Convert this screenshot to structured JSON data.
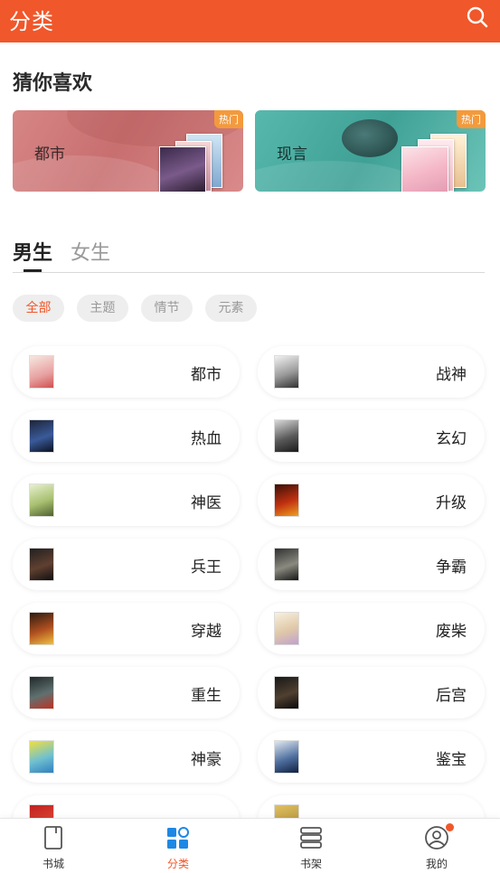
{
  "header": {
    "title": "分类",
    "search_icon": "search-icon"
  },
  "recommend": {
    "title": "猜你喜欢",
    "banners": [
      {
        "label": "都市",
        "badge": "热门",
        "color": "#d27c7d"
      },
      {
        "label": "现言",
        "badge": "热门",
        "color": "#4eafa4"
      }
    ]
  },
  "gender_tabs": {
    "active": "男生",
    "inactive": "女生"
  },
  "filters": [
    {
      "label": "全部",
      "active": true
    },
    {
      "label": "主题",
      "active": false
    },
    {
      "label": "情节",
      "active": false
    },
    {
      "label": "元素",
      "active": false
    }
  ],
  "categories": [
    {
      "label": "都市"
    },
    {
      "label": "战神"
    },
    {
      "label": "热血"
    },
    {
      "label": "玄幻"
    },
    {
      "label": "神医"
    },
    {
      "label": "升级"
    },
    {
      "label": "兵王"
    },
    {
      "label": "争霸"
    },
    {
      "label": "穿越"
    },
    {
      "label": "废柴"
    },
    {
      "label": "重生"
    },
    {
      "label": "后宫"
    },
    {
      "label": "神豪"
    },
    {
      "label": "鉴宝"
    }
  ],
  "bottom_nav": [
    {
      "label": "书城",
      "icon": "book-city-icon",
      "active": false
    },
    {
      "label": "分类",
      "icon": "category-icon",
      "active": true
    },
    {
      "label": "书架",
      "icon": "bookshelf-icon",
      "active": false
    },
    {
      "label": "我的",
      "icon": "profile-icon",
      "active": false,
      "badge_dot": true
    }
  ],
  "colors": {
    "accent": "#f0572b",
    "badge": "#f39a3c"
  }
}
